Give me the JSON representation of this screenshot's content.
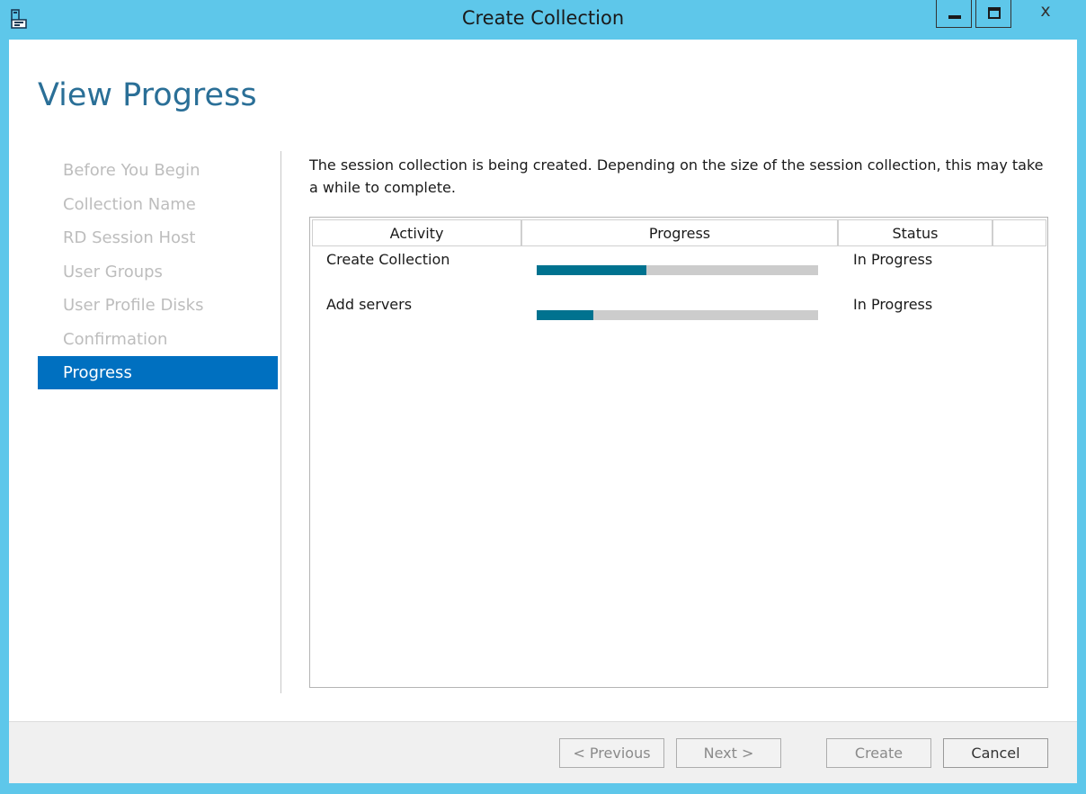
{
  "window": {
    "title": "Create Collection",
    "close_glyph": "x",
    "accent_color": "#5ec7ea"
  },
  "page": {
    "title": "View Progress",
    "description": "The session collection is being created. Depending on the size of the session collection, this may take a while to complete."
  },
  "steps": [
    {
      "label": "Before You Begin",
      "active": false
    },
    {
      "label": "Collection Name",
      "active": false
    },
    {
      "label": "RD Session Host",
      "active": false
    },
    {
      "label": "User Groups",
      "active": false
    },
    {
      "label": "User Profile Disks",
      "active": false
    },
    {
      "label": "Confirmation",
      "active": false
    },
    {
      "label": "Progress",
      "active": true
    }
  ],
  "grid": {
    "columns": [
      "Activity",
      "Progress",
      "Status",
      ""
    ],
    "rows": [
      {
        "activity": "Create Collection",
        "progress_percent": 39,
        "status": "In Progress"
      },
      {
        "activity": "Add servers",
        "progress_percent": 20,
        "status": "In Progress"
      }
    ]
  },
  "buttons": {
    "previous": "< Previous",
    "next": "Next >",
    "create": "Create",
    "cancel": "Cancel"
  },
  "colors": {
    "active_step": "#0070c0",
    "progress_fill": "#00728f",
    "title_color": "#2a6f97"
  },
  "icons": {
    "app": "server-manager-icon",
    "minimize": "minimize-icon",
    "maximize": "maximize-icon",
    "close": "close-icon"
  }
}
